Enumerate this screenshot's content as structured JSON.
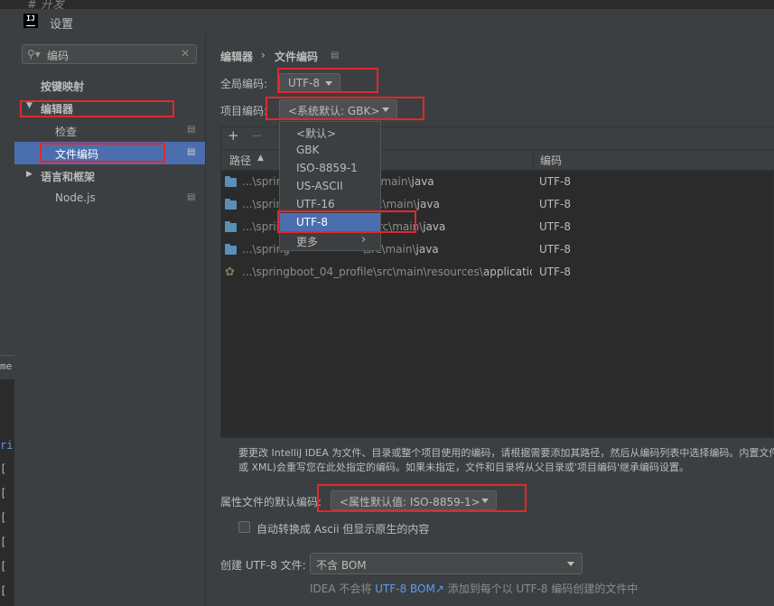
{
  "background": {
    "editor_comment": "# 开发",
    "left_fragment_1": "me",
    "left_fragment_2": "ri",
    "left_glyph": "["
  },
  "window": {
    "title": "设置"
  },
  "sidebar": {
    "search_value": "编码",
    "items": [
      {
        "label": "按键映射"
      },
      {
        "label": "编辑器"
      },
      {
        "label": "检查"
      },
      {
        "label": "文件编码"
      },
      {
        "label": "语言和框架"
      },
      {
        "label": "Node.js"
      }
    ]
  },
  "breadcrumb": {
    "parent": "编辑器",
    "separator": "›",
    "current": "文件编码"
  },
  "global_encoding": {
    "label": "全局编码:",
    "value": "UTF-8"
  },
  "project_encoding": {
    "label": "项目编码:",
    "value": "<系统默认: GBK>"
  },
  "table": {
    "add": "+",
    "remove": "−",
    "columns": {
      "path": "路径",
      "encoding": "编码"
    },
    "rows": [
      {
        "path_prefix": "...\\sprin",
        "path_suffix": "rt\\src\\main\\",
        "path_last": "java",
        "encoding": "UTF-8"
      },
      {
        "path_prefix": "...\\sprin",
        "path_suffix": "nfig\\src\\main\\",
        "path_last": "java",
        "encoding": "UTF-8"
      },
      {
        "path_prefix": "...\\sprin",
        "path_suffix": "a\\src\\main\\",
        "path_last": "java",
        "encoding": "UTF-8"
      },
      {
        "path_prefix": "...\\spring",
        "path_suffix": "\\src\\main\\",
        "path_last": "java",
        "encoding": "UTF-8"
      },
      {
        "path_prefix": "...\\springboot_04_profile\\src\\main\\resources\\",
        "path_suffix": "",
        "path_last": "applicatio",
        "encoding": "UTF-8"
      }
    ]
  },
  "dropdown": {
    "options": [
      "<默认>",
      "GBK",
      "ISO-8859-1",
      "US-ASCII",
      "UTF-16",
      "UTF-8",
      "更多"
    ],
    "selected": "UTF-8",
    "more_arrow": "›"
  },
  "description": {
    "line1": "要更改 IntelliJ IDEA 为文件、目录或整个项目使用的编码，请根据需要添加其路径，然后从编码列表中选择编码。内置文件",
    "line2": "或 XML)会重写您在此处指定的编码。如果未指定，文件和目录将从父目录或'项目编码'继承编码设置。"
  },
  "properties_encoding": {
    "label": "属性文件的默认编码:",
    "value": "<属性默认值: ISO-8859-1>"
  },
  "ascii_option": {
    "label": "自动转换成 Ascii 但显示原生的内容",
    "checked": false
  },
  "utf8_file": {
    "label": "创建 UTF-8 文件:",
    "value": "不含 BOM"
  },
  "bom_note": {
    "prefix": "IDEA 不会将",
    "link": "UTF-8 BOM",
    "arrow": "↗",
    "suffix": "添加到每个以 UTF-8 编码创建的文件中"
  },
  "colors": {
    "highlight_red": "#e0282e",
    "selection_blue": "#4b6eaf",
    "link_blue": "#589df6"
  }
}
